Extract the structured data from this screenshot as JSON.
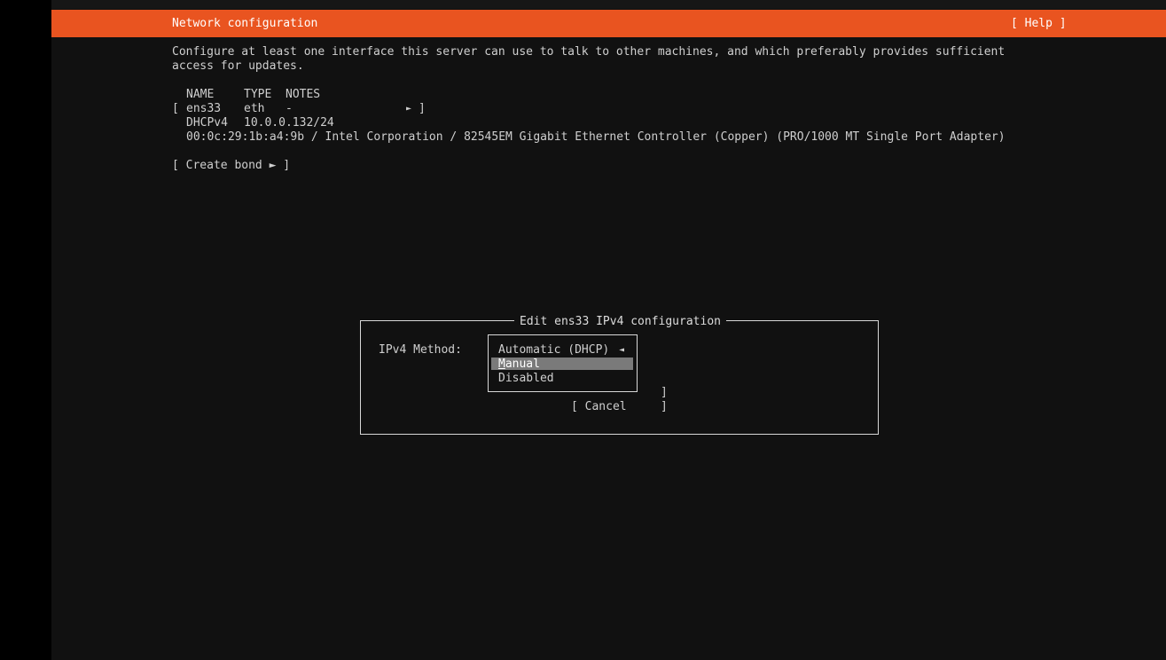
{
  "header": {
    "title": "Network configuration",
    "help_label": "[ Help ]"
  },
  "intro": {
    "line1": "Configure at least one interface this server can use to talk to other machines, and which preferably provides sufficient",
    "line2": "access for updates."
  },
  "table": {
    "headers": {
      "name": "NAME",
      "type": "TYPE",
      "notes": "NOTES"
    },
    "row": {
      "open_bracket": "[",
      "name": "ens33",
      "type": "eth",
      "notes": "-",
      "arrow": "►",
      "close_bracket": "]"
    },
    "detail_dhcp_label": "DHCPv4",
    "detail_dhcp_value": "10.0.0.132/24",
    "detail_hw": "00:0c:29:1b:a4:9b / Intel Corporation / 82545EM Gigabit Ethernet Controller (Copper) (PRO/1000 MT Single Port Adapter)"
  },
  "create_bond_label": "[ Create bond ► ]",
  "dialog": {
    "title": "Edit ens33 IPv4 configuration",
    "method_label": "IPv4 Method:",
    "options": {
      "automatic": "Automatic (DHCP)",
      "automatic_marker": "◄",
      "manual_first": "M",
      "manual_rest": "anual",
      "disabled": "Disabled"
    },
    "save_bracket": "]",
    "cancel_open": "[ Cancel",
    "cancel_close": "]"
  },
  "colors": {
    "accent": "#e95420",
    "background": "#111111",
    "highlight": "#7a7a7a"
  }
}
